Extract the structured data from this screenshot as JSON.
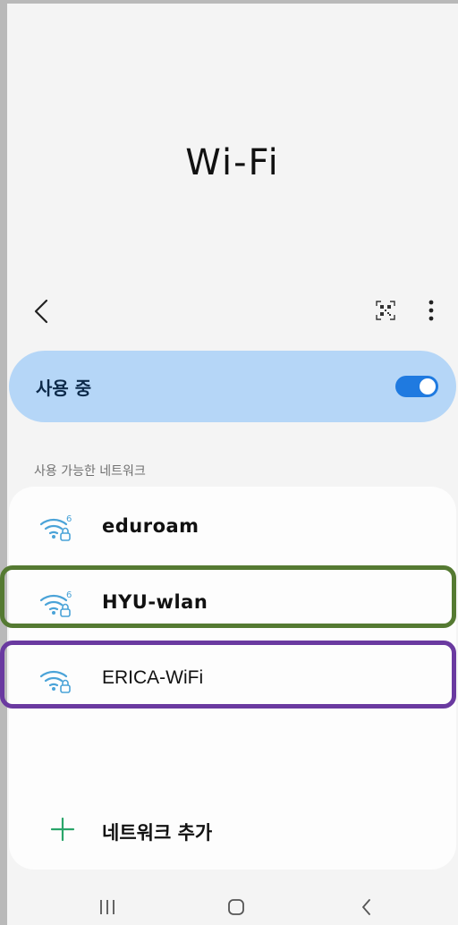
{
  "header": {
    "title": "Wi-Fi"
  },
  "toolbar": {
    "back_icon": "chevron-left-icon",
    "qr_icon": "qr-scan-icon",
    "more_icon": "more-vert-icon"
  },
  "master": {
    "label": "사용 중",
    "enabled": true,
    "accent": "#1f7ae0",
    "background": "#b5d6f7"
  },
  "networks": {
    "section_label": "사용 가능한 네트워크",
    "items": [
      {
        "name": "eduroam",
        "icon": "wifi-6-lock-icon",
        "highlight": null
      },
      {
        "name": "HYU-wlan",
        "icon": "wifi-6-lock-icon",
        "highlight": "#557a32"
      },
      {
        "name": "ERICA-WiFi",
        "icon": "wifi-lock-icon",
        "highlight": "#6a3aa0"
      }
    ],
    "add_label": "네트워크 추가"
  },
  "navbar": {
    "recents_icon": "recents-icon",
    "home_icon": "home-icon",
    "back_icon": "back-icon"
  }
}
